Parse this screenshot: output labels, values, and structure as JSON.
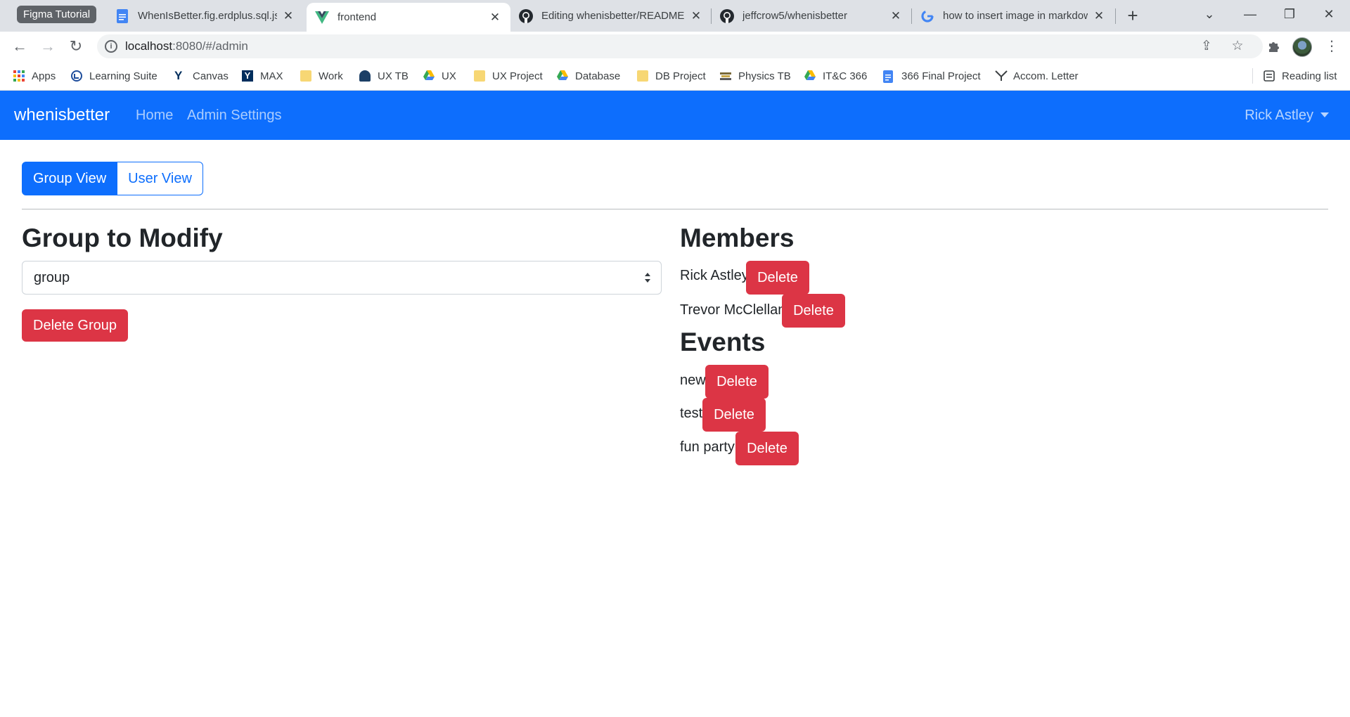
{
  "browser": {
    "tab_group_label": "Figma Tutorial",
    "tabs": [
      {
        "title": "WhenIsBetter.fig.erdplus.sql.json",
        "icon": "google-docs-icon"
      },
      {
        "title": "frontend",
        "icon": "vue-icon",
        "active": true
      },
      {
        "title": "Editing whenisbetter/README.md",
        "icon": "github-icon"
      },
      {
        "title": "jeffcrow5/whenisbetter",
        "icon": "github-icon"
      },
      {
        "title": "how to insert image in markdown",
        "icon": "google-icon"
      }
    ],
    "url_host": "localhost",
    "url_path": ":8080/#/admin",
    "bookmarks": [
      {
        "label": "Apps",
        "icon": "apps-grid-icon"
      },
      {
        "label": "Learning Suite",
        "icon": "learning-suite-icon"
      },
      {
        "label": "Canvas",
        "icon": "byu-y-icon"
      },
      {
        "label": "MAX",
        "icon": "max-y-icon"
      },
      {
        "label": "Work",
        "icon": "folder-icon"
      },
      {
        "label": "UX TB",
        "icon": "ux-tb-icon"
      },
      {
        "label": "UX",
        "icon": "google-drive-icon"
      },
      {
        "label": "UX Project",
        "icon": "folder-icon"
      },
      {
        "label": "Database",
        "icon": "google-drive-icon"
      },
      {
        "label": "DB Project",
        "icon": "folder-icon"
      },
      {
        "label": "Physics TB",
        "icon": "physics-tb-icon"
      },
      {
        "label": "IT&C 366",
        "icon": "google-drive-icon"
      },
      {
        "label": "366 Final Project",
        "icon": "google-docs-icon"
      },
      {
        "label": "Accom. Letter",
        "icon": "accom-letter-icon"
      }
    ],
    "reading_list": "Reading list"
  },
  "navbar": {
    "brand": "whenisbetter",
    "links": [
      "Home",
      "Admin Settings"
    ],
    "user": "Rick Astley"
  },
  "view_toggle": {
    "group_view": "Group View",
    "user_view": "User View"
  },
  "left": {
    "heading": "Group to Modify",
    "select_value": "group",
    "delete_group": "Delete Group"
  },
  "members": {
    "heading": "Members",
    "items": [
      "Rick Astley",
      "Trevor McClellan"
    ]
  },
  "events": {
    "heading": "Events",
    "items": [
      "new",
      "test",
      "fun party"
    ]
  },
  "delete_label": "Delete",
  "colors": {
    "primary": "#0d6efd",
    "danger": "#dc3545"
  }
}
